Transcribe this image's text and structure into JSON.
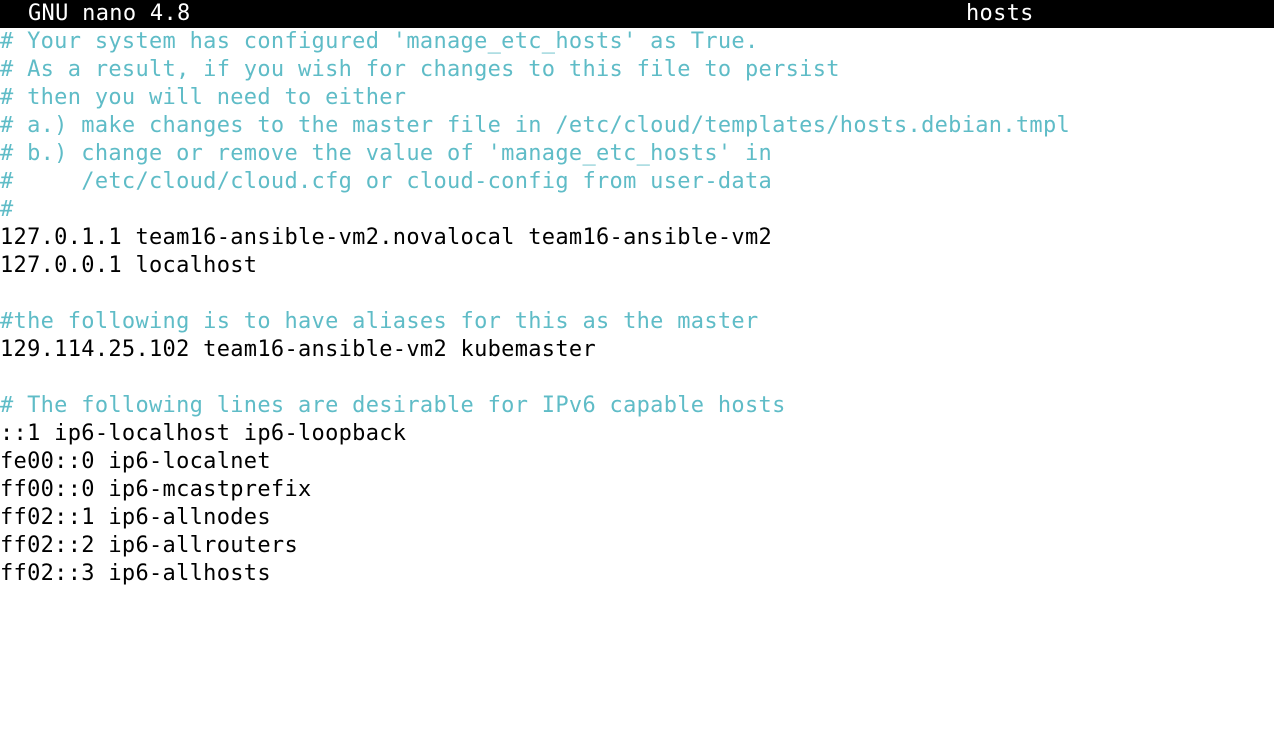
{
  "titlebar": {
    "app_version": "GNU nano 4.8",
    "filename": "hosts"
  },
  "colors": {
    "titlebar_bg": "#000000",
    "titlebar_fg": "#ffffff",
    "comment": "#5fbcc7",
    "text": "#000000",
    "background": "#ffffff"
  },
  "editor": {
    "lines": [
      {
        "text": "# Your system has configured 'manage_etc_hosts' as True.",
        "kind": "comment"
      },
      {
        "text": "# As a result, if you wish for changes to this file to persist",
        "kind": "comment"
      },
      {
        "text": "# then you will need to either",
        "kind": "comment"
      },
      {
        "text": "# a.) make changes to the master file in /etc/cloud/templates/hosts.debian.tmpl",
        "kind": "comment"
      },
      {
        "text": "# b.) change or remove the value of 'manage_etc_hosts' in",
        "kind": "comment"
      },
      {
        "text": "#     /etc/cloud/cloud.cfg or cloud-config from user-data",
        "kind": "comment"
      },
      {
        "text": "#",
        "kind": "comment"
      },
      {
        "text": "127.0.1.1 team16-ansible-vm2.novalocal team16-ansible-vm2",
        "kind": "text"
      },
      {
        "text": "127.0.0.1 localhost",
        "kind": "text"
      },
      {
        "text": "",
        "kind": "text"
      },
      {
        "text": "#the following is to have aliases for this as the master",
        "kind": "comment"
      },
      {
        "text": "129.114.25.102 team16-ansible-vm2 kubemaster",
        "kind": "text"
      },
      {
        "text": "",
        "kind": "text"
      },
      {
        "text": "# The following lines are desirable for IPv6 capable hosts",
        "kind": "comment"
      },
      {
        "text": "::1 ip6-localhost ip6-loopback",
        "kind": "text"
      },
      {
        "text": "fe00::0 ip6-localnet",
        "kind": "text"
      },
      {
        "text": "ff00::0 ip6-mcastprefix",
        "kind": "text"
      },
      {
        "text": "ff02::1 ip6-allnodes",
        "kind": "text"
      },
      {
        "text": "ff02::2 ip6-allrouters",
        "kind": "text"
      },
      {
        "text": "ff02::3 ip6-allhosts",
        "kind": "text"
      }
    ]
  }
}
